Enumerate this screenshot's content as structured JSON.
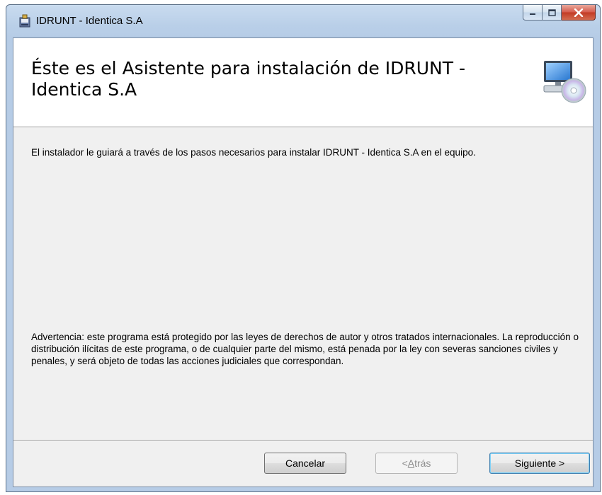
{
  "window": {
    "title": "IDRUNT - Identica S.A",
    "controls": {
      "minimize": "minimize",
      "maximize": "maximize",
      "close": "close"
    }
  },
  "banner": {
    "title": "Éste es el Asistente para instalación de IDRUNT - Identica S.A",
    "icon": "computer-cd-icon"
  },
  "body": {
    "intro": "El instalador le guiará a través de los pasos necesarios para instalar IDRUNT - Identica S.A en el equipo.",
    "warning": "Advertencia: este programa está protegido por las leyes de derechos de autor y otros tratados internacionales. La reproducción o distribución ilícitas de este programa, o de cualquier parte del mismo, está penada por la ley con severas sanciones civiles y penales, y será objeto de todas las acciones judiciales que correspondan."
  },
  "buttons": {
    "cancel": "Cancelar",
    "back_prefix": "< ",
    "back_mnemonic": "A",
    "back_rest": "trás",
    "next": "Siguiente >"
  },
  "colors": {
    "titlebar": "#b9cfe8",
    "client_bg": "#f0f0f0",
    "close_button": "#c23a25"
  }
}
